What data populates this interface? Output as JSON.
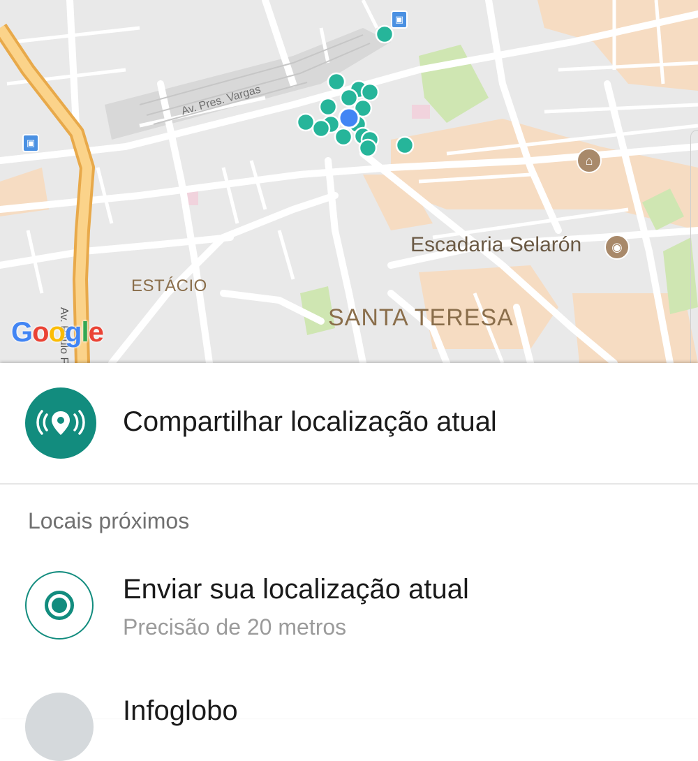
{
  "map": {
    "labels": {
      "street_vargas": "Av. Pres. Vargas",
      "street_paulo": "Av. Paulo Fro",
      "estacio": "ESTÁCIO",
      "santa_teresa": "SANTA TERESA",
      "selaron": "Escadaria Selarón"
    },
    "google_logo": [
      "G",
      "o",
      "o",
      "g",
      "l",
      "e"
    ],
    "colors": {
      "pin": "#26b59a",
      "current_location": "#4285f4",
      "highway": "#f6c26b",
      "park": "#cde8b0",
      "urban": "#f5dcc4"
    }
  },
  "share_current": {
    "label": "Compartilhar localização atual",
    "icon": "live-location-icon"
  },
  "nearby": {
    "header": "Locais próximos",
    "send_current": {
      "title": "Enviar sua localização atual",
      "subtitle": "Precisão de 20 metros",
      "icon": "current-location-radio-icon"
    },
    "places": [
      {
        "title": "Infoglobo",
        "icon": "place-icon"
      }
    ]
  },
  "accent_color": "#128c7e"
}
